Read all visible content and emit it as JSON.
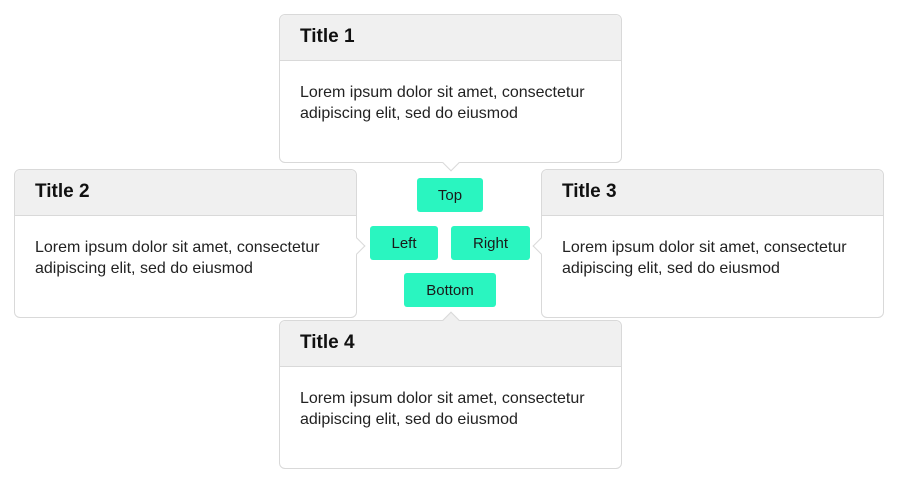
{
  "popovers": {
    "top": {
      "title": "Title 1",
      "body": "Lorem ipsum dolor sit amet, consectetur adipiscing elit, sed do eiusmod"
    },
    "left": {
      "title": "Title 2",
      "body": "Lorem ipsum dolor sit amet, consectetur adipiscing elit, sed do eiusmod"
    },
    "right": {
      "title": "Title 3",
      "body": "Lorem ipsum dolor sit amet, consectetur adipiscing elit, sed do eiusmod"
    },
    "bottom": {
      "title": "Title 4",
      "body": "Lorem ipsum dolor sit amet, consectetur adipiscing elit, sed do eiusmod"
    }
  },
  "buttons": {
    "top": "Top",
    "left": "Left",
    "right": "Right",
    "bottom": "Bottom"
  },
  "colors": {
    "button_accent": "#2af5c0",
    "header_bg": "#f0f0f0",
    "border": "#d9d9d9"
  }
}
